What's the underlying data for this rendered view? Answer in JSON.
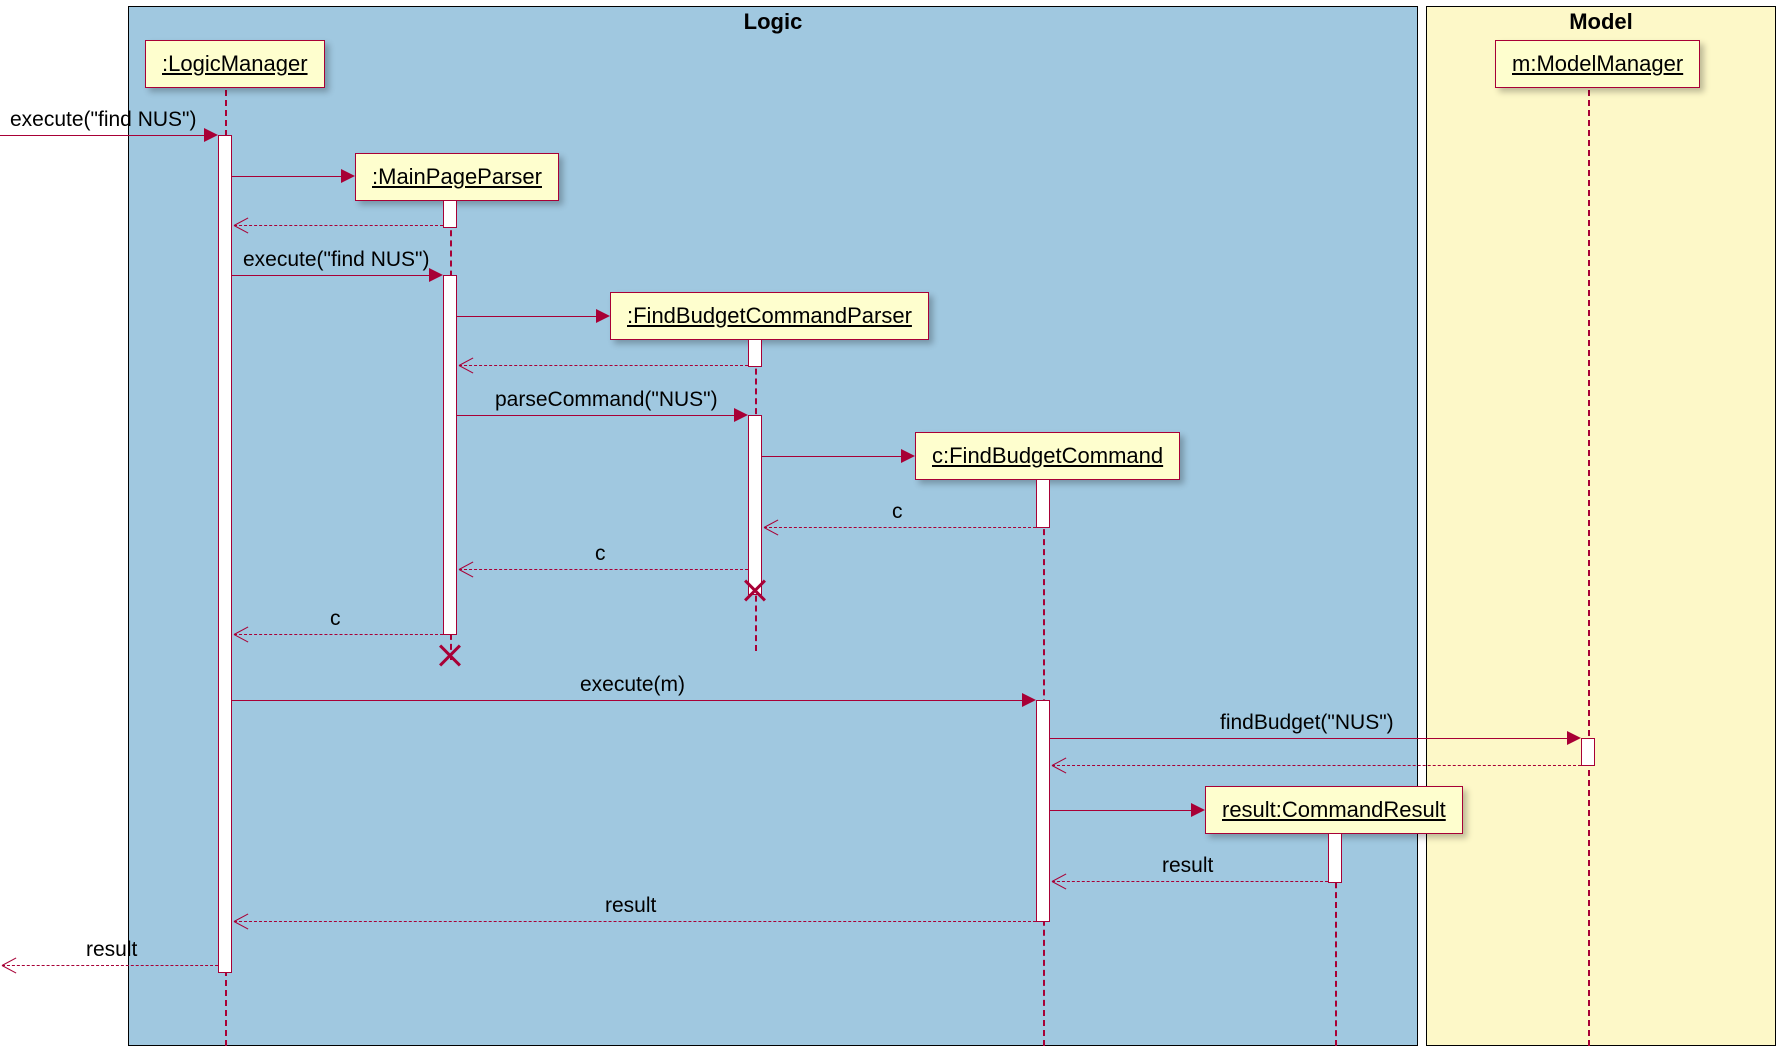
{
  "frames": {
    "logic_title": "Logic",
    "model_title": "Model"
  },
  "participants": {
    "logic_manager": ":LogicManager",
    "main_page_parser": ":MainPageParser",
    "find_budget_command_parser": ":FindBudgetCommandParser",
    "find_budget_command": "c:FindBudgetCommand",
    "command_result": "result:CommandResult",
    "model_manager": "m:ModelManager"
  },
  "messages": {
    "m1": "execute(\"find NUS\")",
    "m2": "execute(\"find NUS\")",
    "m3": "parseCommand(\"NUS\")",
    "r_c1": "c",
    "r_c2": "c",
    "r_c3": "c",
    "m4": "execute(m)",
    "m5": "findBudget(\"NUS\")",
    "r_res1": "result",
    "r_res2": "result",
    "r_res3": "result"
  },
  "chart_data": {
    "type": "sequence_diagram",
    "frames": [
      {
        "name": "Logic",
        "contains": [
          ":LogicManager",
          ":MainPageParser",
          ":FindBudgetCommandParser",
          "c:FindBudgetCommand",
          "result:CommandResult"
        ]
      },
      {
        "name": "Model",
        "contains": [
          "m:ModelManager"
        ]
      }
    ],
    "participants": [
      {
        "id": "caller",
        "label": "(external)"
      },
      {
        "id": "lm",
        "label": ":LogicManager"
      },
      {
        "id": "mpp",
        "label": ":MainPageParser"
      },
      {
        "id": "fbcp",
        "label": ":FindBudgetCommandParser"
      },
      {
        "id": "fbc",
        "label": "c:FindBudgetCommand"
      },
      {
        "id": "cr",
        "label": "result:CommandResult"
      },
      {
        "id": "mm",
        "label": "m:ModelManager"
      }
    ],
    "interactions": [
      {
        "from": "caller",
        "to": "lm",
        "label": "execute(\"find NUS\")",
        "type": "call"
      },
      {
        "from": "lm",
        "to": "mpp",
        "label": "",
        "type": "create"
      },
      {
        "from": "mpp",
        "to": "lm",
        "label": "",
        "type": "return"
      },
      {
        "from": "lm",
        "to": "mpp",
        "label": "execute(\"find NUS\")",
        "type": "call"
      },
      {
        "from": "mpp",
        "to": "fbcp",
        "label": "",
        "type": "create"
      },
      {
        "from": "fbcp",
        "to": "mpp",
        "label": "",
        "type": "return"
      },
      {
        "from": "mpp",
        "to": "fbcp",
        "label": "parseCommand(\"NUS\")",
        "type": "call"
      },
      {
        "from": "fbcp",
        "to": "fbc",
        "label": "",
        "type": "create"
      },
      {
        "from": "fbc",
        "to": "fbcp",
        "label": "c",
        "type": "return"
      },
      {
        "from": "fbcp",
        "to": "mpp",
        "label": "c",
        "type": "return"
      },
      {
        "from": "fbcp",
        "action": "destroy"
      },
      {
        "from": "mpp",
        "to": "lm",
        "label": "c",
        "type": "return"
      },
      {
        "from": "mpp",
        "action": "destroy"
      },
      {
        "from": "lm",
        "to": "fbc",
        "label": "execute(m)",
        "type": "call"
      },
      {
        "from": "fbc",
        "to": "mm",
        "label": "findBudget(\"NUS\")",
        "type": "call"
      },
      {
        "from": "mm",
        "to": "fbc",
        "label": "",
        "type": "return"
      },
      {
        "from": "fbc",
        "to": "cr",
        "label": "",
        "type": "create"
      },
      {
        "from": "cr",
        "to": "fbc",
        "label": "result",
        "type": "return"
      },
      {
        "from": "fbc",
        "to": "lm",
        "label": "result",
        "type": "return"
      },
      {
        "from": "lm",
        "to": "caller",
        "label": "result",
        "type": "return"
      }
    ]
  }
}
